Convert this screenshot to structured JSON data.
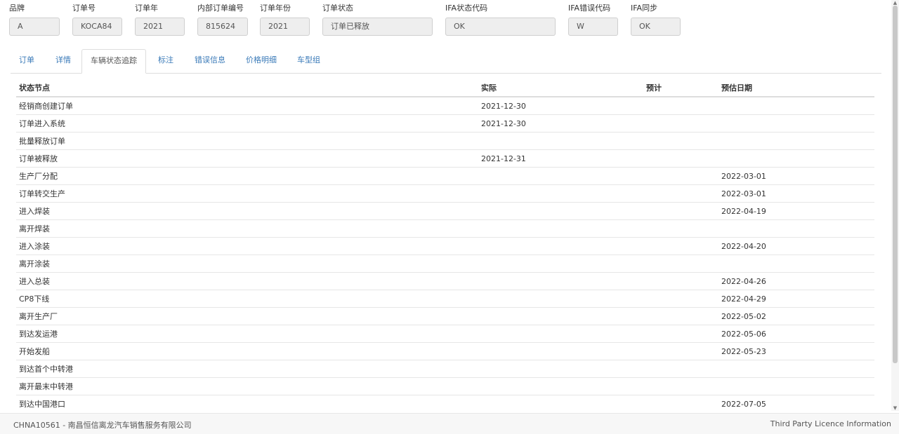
{
  "header": {
    "fields": [
      {
        "label": "品牌",
        "value": "A"
      },
      {
        "label": "订单号",
        "value": "KOCA84"
      },
      {
        "label": "订单年",
        "value": "2021"
      },
      {
        "label": "内部订单编号",
        "value": "815624"
      },
      {
        "label": "订单年份",
        "value": "2021"
      },
      {
        "label": "订单状态",
        "value": "订单已释放"
      },
      {
        "label": "IFA状态代码",
        "value": "OK"
      },
      {
        "label": "IFA错误代码",
        "value": "W"
      },
      {
        "label": "IFA同步",
        "value": "OK"
      }
    ]
  },
  "tabs": [
    {
      "label": "订单",
      "active": false
    },
    {
      "label": "详情",
      "active": false
    },
    {
      "label": "车辆状态追踪",
      "active": true
    },
    {
      "label": "标注",
      "active": false
    },
    {
      "label": "错误信息",
      "active": false
    },
    {
      "label": "价格明细",
      "active": false
    },
    {
      "label": "车型组",
      "active": false
    }
  ],
  "table": {
    "columns": [
      "状态节点",
      "实际",
      "预计",
      "预估日期"
    ],
    "rows": [
      [
        "经销商创建订单",
        "2021-12-30",
        "",
        ""
      ],
      [
        "订单进入系统",
        "2021-12-30",
        "",
        ""
      ],
      [
        "批量释放订单",
        "",
        "",
        ""
      ],
      [
        "订单被释放",
        "2021-12-31",
        "",
        ""
      ],
      [
        "生产厂分配",
        "",
        "",
        "2022-03-01"
      ],
      [
        "订单转交生产",
        "",
        "",
        "2022-03-01"
      ],
      [
        "进入焊装",
        "",
        "",
        "2022-04-19"
      ],
      [
        "离开焊装",
        "",
        "",
        ""
      ],
      [
        "进入涂装",
        "",
        "",
        "2022-04-20"
      ],
      [
        "离开涂装",
        "",
        "",
        ""
      ],
      [
        "进入总装",
        "",
        "",
        "2022-04-26"
      ],
      [
        "CP8下线",
        "",
        "",
        "2022-04-29"
      ],
      [
        "离开生产厂",
        "",
        "",
        "2022-05-02"
      ],
      [
        "到达发运港",
        "",
        "",
        "2022-05-06"
      ],
      [
        "开始发船",
        "",
        "",
        "2022-05-23"
      ],
      [
        "到达首个中转港",
        "",
        "",
        ""
      ],
      [
        "离开最末中转港",
        "",
        "",
        ""
      ],
      [
        "到达中国港口",
        "",
        "",
        "2022-07-05"
      ]
    ]
  },
  "footer": {
    "dealer": "CHNA10561 - 南昌恒信离龙汽车销售服务有限公司",
    "licence_link": "Third Party Licence Information"
  },
  "icons": {
    "scroll_up": "scroll-up-arrow-icon",
    "scroll_down": "scroll-down-arrow-icon"
  }
}
